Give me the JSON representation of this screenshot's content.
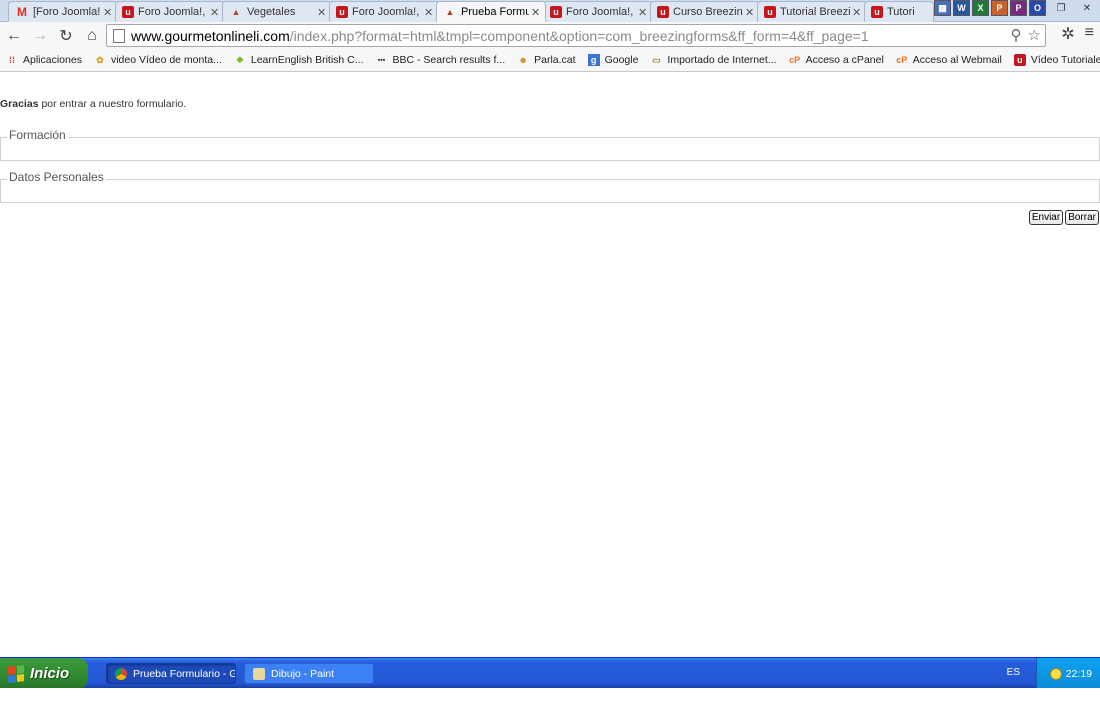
{
  "browser": {
    "tabs": [
      {
        "title": "[Foro Joomla!,",
        "icon": "gmail-icon"
      },
      {
        "title": "Foro Joomla!, ",
        "icon": "joomla-forum-icon"
      },
      {
        "title": "Vegetales",
        "icon": "hat-icon"
      },
      {
        "title": "Foro Joomla!, ",
        "icon": "joomla-forum-icon"
      },
      {
        "title": "Prueba Formul",
        "icon": "hat-icon",
        "active": true
      },
      {
        "title": "Foro Joomla!, ",
        "icon": "joomla-forum-icon"
      },
      {
        "title": "Curso Breezing",
        "icon": "joomla-forum-icon"
      },
      {
        "title": "Tutorial Breezi",
        "icon": "joomla-forum-icon"
      },
      {
        "title": "Tutori",
        "icon": "joomla-forum-icon"
      }
    ],
    "url_host": "www.gourmetonlineli.com",
    "url_path": "/index.php?format=html&tmpl=component&option=com_breezingforms&ff_form=4&ff_page=1",
    "bookmarks": [
      {
        "label": "Aplicaciones",
        "icon": "apps-grid-icon"
      },
      {
        "label": "video Vídeo de monta...",
        "icon": "video-bookmark-icon"
      },
      {
        "label": "LearnEnglish  British C...",
        "icon": "learnenglish-icon"
      },
      {
        "label": "BBC - Search results f...",
        "icon": "bbc-icon"
      },
      {
        "label": "Parla.cat",
        "icon": "parla-icon"
      },
      {
        "label": "Google",
        "icon": "google-icon"
      },
      {
        "label": "Importado de Internet...",
        "icon": "folder-icon"
      },
      {
        "label": "Acceso a cPanel",
        "icon": "cpanel-icon"
      },
      {
        "label": "Acceso al Webmail",
        "icon": "cpanel-icon"
      },
      {
        "label": "Vídeo Tutoriales Pack ...",
        "icon": "joomla-forum-icon"
      }
    ]
  },
  "page": {
    "thanks_bold": "Gracias",
    "thanks_rest": " por entrar a nuestro formulario.",
    "section_1": "Formación",
    "section_2": "Datos Personales",
    "submit_label": "Enviar",
    "reset_label": "Borrar"
  },
  "taskbar": {
    "start_label": "Inicio",
    "tasks": [
      {
        "label": "Prueba Formulario - G...",
        "active": true
      },
      {
        "label": "Dibujo - Paint",
        "active": false
      }
    ],
    "language": "ES",
    "clock": "22:19"
  },
  "colors": {
    "taskbar": "#245edb",
    "start": "#2f8a2f",
    "tray": "#0fa1ef"
  }
}
